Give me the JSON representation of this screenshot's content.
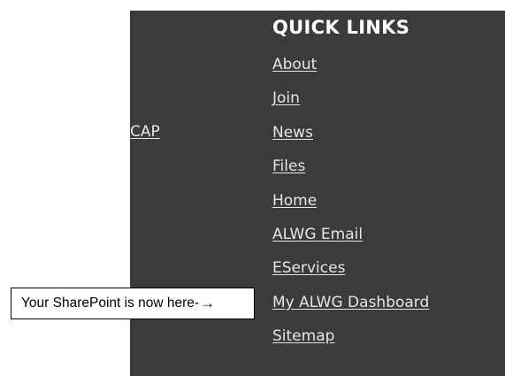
{
  "left_link": {
    "label": "CAP"
  },
  "quick_links": {
    "title": "QUICK LINKS",
    "items": [
      {
        "label": "About"
      },
      {
        "label": "Join"
      },
      {
        "label": "News"
      },
      {
        "label": "Files"
      },
      {
        "label": "Home"
      },
      {
        "label": "ALWG Email"
      },
      {
        "label": "EServices"
      },
      {
        "label": "My ALWG Dashboard"
      },
      {
        "label": "Sitemap"
      }
    ]
  },
  "callout": {
    "text": "Your SharePoint is now here-",
    "arrow": "→"
  },
  "colors": {
    "panel_background": "#3a3b3c",
    "link_text": "#e6e6e6",
    "title_text": "#ffffff"
  }
}
